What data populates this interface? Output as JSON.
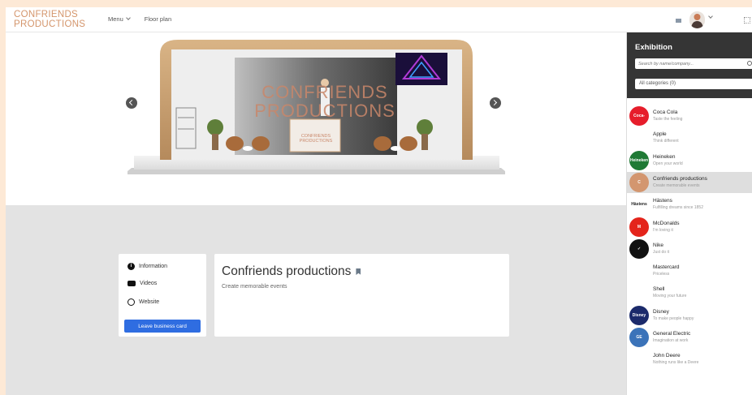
{
  "header": {
    "logo_line1": "CONFRIENDS",
    "logo_line2": "PRODUCTIONS",
    "nav": [
      {
        "label": "Menu",
        "has_dropdown": true
      },
      {
        "label": "Floor plan",
        "has_dropdown": false
      }
    ],
    "icons": [
      "mail-icon",
      "user-avatar",
      "chevron-down-icon",
      "expand-icon"
    ]
  },
  "booth": {
    "wall_title_line1": "CONFRIENDS",
    "wall_title_line2": "PRODUCTIONS",
    "desk_logo_line1": "CONFRIENDS",
    "desk_logo_line2": "PRODUCTIONS"
  },
  "info_card": {
    "links": [
      {
        "label": "Information",
        "icon": "info-icon"
      },
      {
        "label": "Videos",
        "icon": "youtube-icon"
      },
      {
        "label": "Website",
        "icon": "globe-icon"
      }
    ],
    "button_label": "Leave business card",
    "button_color": "#2f6de1"
  },
  "company": {
    "name": "Confriends productions",
    "tagline": "Create memorable events"
  },
  "panel": {
    "title": "Exhibition",
    "search_placeholder": "Search by name/company...",
    "category_select": "All categories (0)",
    "exhibitors": [
      {
        "name": "Coca Cola",
        "tagline": "Taste the feeling",
        "color": "#e61d2b",
        "logo_text": "Coca-Cola",
        "active": false
      },
      {
        "name": "Apple",
        "tagline": "Think different",
        "color": "#ffffff",
        "logo_text": "",
        "active": false
      },
      {
        "name": "Heineken",
        "tagline": "Open your world",
        "color": "#1f7a35",
        "logo_text": "Heineken",
        "active": false
      },
      {
        "name": "Confriends productions",
        "tagline": "Create memorable events",
        "color": "#d3966f",
        "logo_text": "C",
        "active": true
      },
      {
        "name": "Hästens",
        "tagline": "Fulfilling dreams since 1852",
        "color": "#ffffff",
        "logo_text": "Hästens",
        "active": false
      },
      {
        "name": "McDonalds",
        "tagline": "I'm loving it",
        "color": "#e4241b",
        "logo_text": "M",
        "active": false
      },
      {
        "name": "Nike",
        "tagline": "Just do it",
        "color": "#111111",
        "logo_text": "✓",
        "active": false
      },
      {
        "name": "Mastercard",
        "tagline": "Priceless",
        "color": "#ffffff",
        "logo_text": "",
        "active": false
      },
      {
        "name": "Shell",
        "tagline": "Moving your future",
        "color": "#ffffff",
        "logo_text": "",
        "active": false
      },
      {
        "name": "Disney",
        "tagline": "To make people happy",
        "color": "#1b2a6b",
        "logo_text": "Disney",
        "active": false
      },
      {
        "name": "General Electric",
        "tagline": "Imagination at work",
        "color": "#3b73b9",
        "logo_text": "GE",
        "active": false
      },
      {
        "name": "John Deere",
        "tagline": "Nothing runs like a Deere",
        "color": "#ffffff",
        "logo_text": "",
        "active": false
      }
    ]
  }
}
